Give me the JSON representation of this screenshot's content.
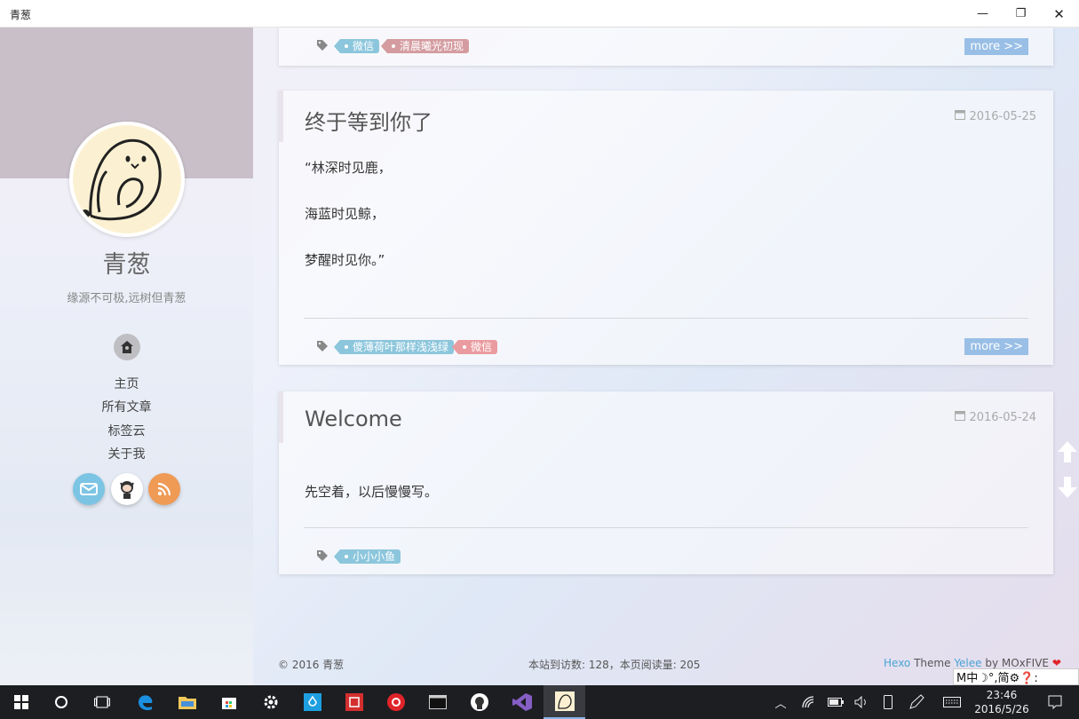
{
  "window": {
    "title": "青葱",
    "minimize": "—",
    "maximize": "❐",
    "close": "✕"
  },
  "sidebar": {
    "name": "青葱",
    "motto": "缘源不可极,远树但青葱",
    "nav": [
      {
        "label": "主页"
      },
      {
        "label": "所有文章"
      },
      {
        "label": "标签云"
      },
      {
        "label": "关于我"
      }
    ]
  },
  "posts": [
    {
      "tags": [
        "微信",
        "清晨曦光初现"
      ],
      "more": "more >>"
    },
    {
      "title": "终于等到你了",
      "date": "2016-05-25",
      "lines": [
        "“林深时见鹿，",
        "海蓝时见鲸，",
        "梦醒时见你。”"
      ],
      "tags": [
        "傻薄荷叶那样浅浅绿",
        "微信"
      ],
      "more": "more >>"
    },
    {
      "title": "Welcome",
      "date": "2016-05-24",
      "lines": [
        "先空着，以后慢慢写。"
      ],
      "tags": [
        "小小小鱼"
      ]
    }
  ],
  "footer": {
    "copyright": "© 2016 青葱",
    "stats": "本站到访数: 128，本页阅读量: 205",
    "credit_hexo": "Hexo",
    "credit_theme": " Theme ",
    "credit_yelee": "Yelee",
    "credit_by": " by MOxFIVE ",
    "heart": "❤"
  },
  "ime": {
    "text": "M中☽°,简⚙❓:"
  },
  "taskbar": {
    "time": "23:46",
    "date": "2016/5/26"
  },
  "colors": {
    "accent": "#99bfe6",
    "tag_blue": "#8cc6dc",
    "tag_pink": "#d49ca0",
    "link": "#4aa3d6",
    "heart": "#e0242a"
  }
}
